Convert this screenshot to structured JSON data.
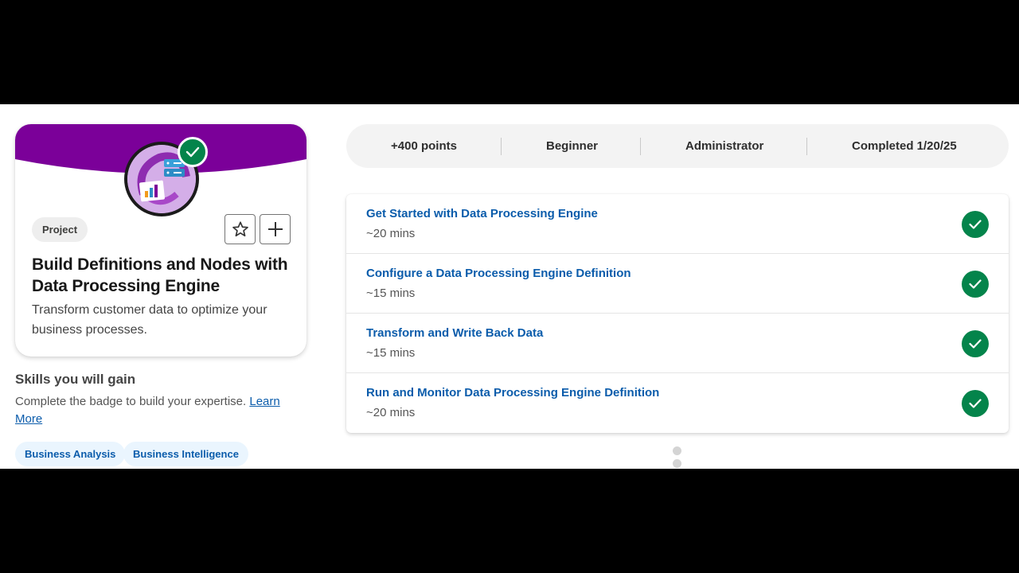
{
  "colors": {
    "banner": "#7b0099",
    "complete": "#04844b",
    "link": "#0b5cab"
  },
  "badge": {
    "type_label": "Project",
    "title": "Build Definitions and Nodes with Data Processing Engine",
    "description": "Transform customer data to optimize your business processes.",
    "icon": "data-processing-badge-icon",
    "completed_icon": "check-icon",
    "favorite_icon": "star-icon",
    "add_icon": "plus-icon"
  },
  "skills": {
    "title": "Skills you will gain",
    "description": "Complete the badge to build your expertise. ",
    "learn_more": "Learn More",
    "tags": [
      "Business Analysis",
      "Business Intelligence"
    ]
  },
  "stats": {
    "points": "+400 points",
    "level": "Beginner",
    "role": "Administrator",
    "completed": "Completed 1/20/25"
  },
  "units": [
    {
      "title": "Get Started with Data Processing Engine",
      "time": "~20 mins",
      "status": "complete"
    },
    {
      "title": "Configure a Data Processing Engine Definition",
      "time": "~15 mins",
      "status": "complete"
    },
    {
      "title": "Transform and Write Back Data",
      "time": "~15 mins",
      "status": "complete"
    },
    {
      "title": "Run and Monitor Data Processing Engine Definition",
      "time": "~20 mins",
      "status": "complete"
    }
  ]
}
